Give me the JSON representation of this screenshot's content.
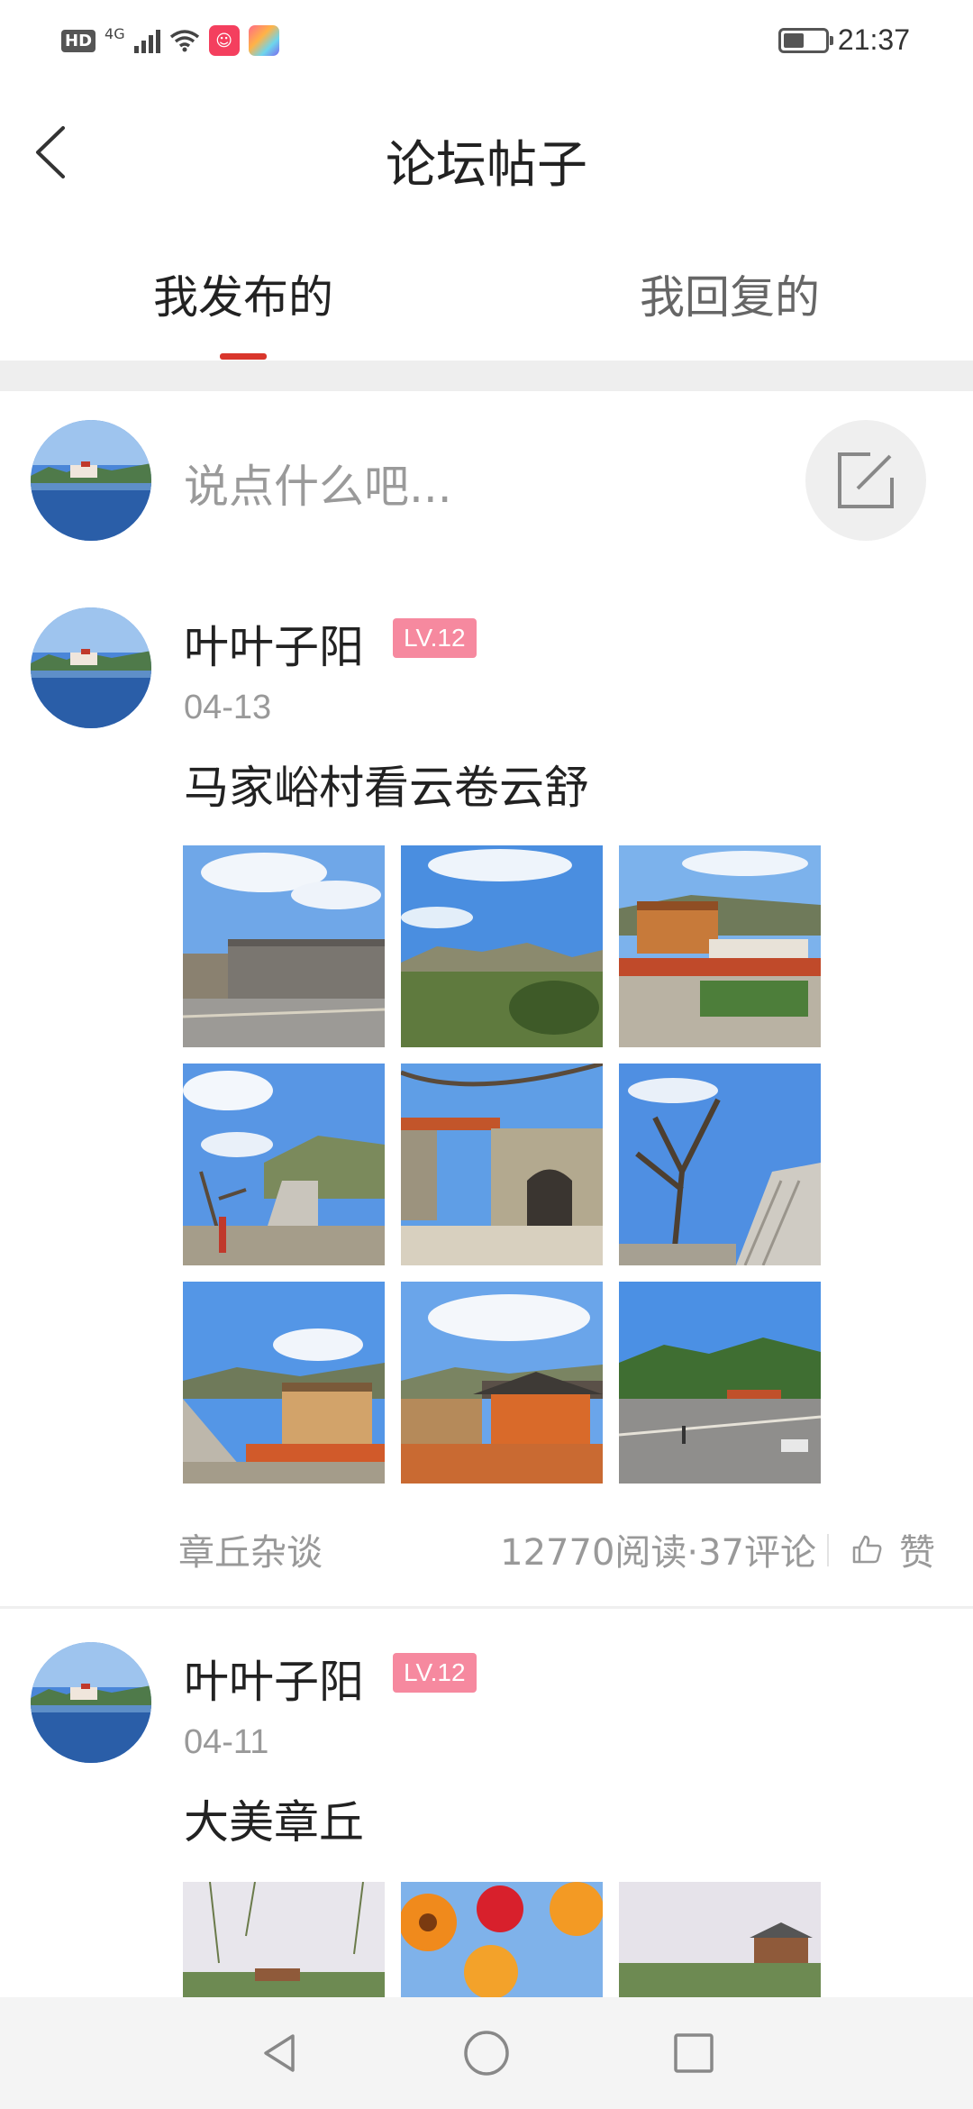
{
  "status_bar": {
    "network": "HD",
    "signal_type": "4G",
    "time": "21:37",
    "battery_level": 0.4
  },
  "header": {
    "title": "论坛帖子",
    "back_icon": "chevron-left-icon"
  },
  "tabs": [
    {
      "label": "我发布的",
      "active": true
    },
    {
      "label": "我回复的",
      "active": false
    }
  ],
  "composer": {
    "placeholder": "说点什么吧...",
    "edit_icon": "compose-icon"
  },
  "posts": [
    {
      "username": "叶叶子阳",
      "level": "LV.12",
      "date": "04-13",
      "title": "马家峪村看云卷云舒",
      "image_count": 9,
      "forum": "章丘杂谈",
      "stats": "12770阅读·37评论",
      "like_label": "赞"
    },
    {
      "username": "叶叶子阳",
      "level": "LV.12",
      "date": "04-11",
      "title": "大美章丘",
      "image_count": 3
    }
  ],
  "colors": {
    "accent": "#d9362c",
    "badge": "#f6899f"
  }
}
